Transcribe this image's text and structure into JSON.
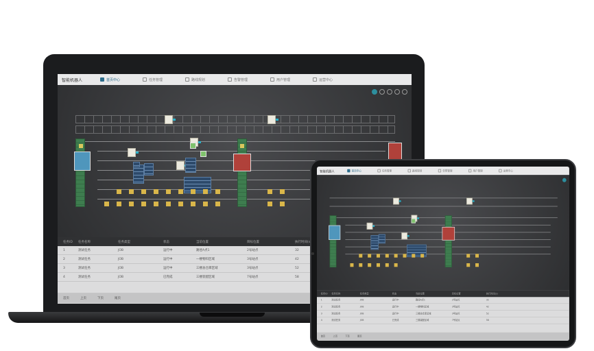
{
  "app": {
    "title": "智能机器人",
    "nav": [
      {
        "label": "首页中心",
        "icon": "dashboard-icon",
        "active": true
      },
      {
        "label": "任务管理",
        "icon": "task-icon",
        "active": false
      },
      {
        "label": "路线规划",
        "icon": "route-icon",
        "active": false
      },
      {
        "label": "告警管理",
        "icon": "alarm-icon",
        "active": false
      },
      {
        "label": "用户管理",
        "icon": "user-icon",
        "active": false
      },
      {
        "label": "运营中心",
        "icon": "ops-icon",
        "active": false
      }
    ],
    "pages": [
      "1",
      "2",
      "3",
      "4",
      "5"
    ],
    "table": {
      "headers": [
        "任务ID",
        "任务名称",
        "任务类型",
        "状态",
        "当前位置",
        "目标位置",
        "执行时间(s)"
      ],
      "rows": [
        [
          "1",
          "测试任务",
          "JOB",
          "运行中",
          "路径A点1",
          "2号站点",
          "32"
        ],
        [
          "2",
          "测试任务",
          "JOB",
          "运行中",
          "一楼物料区域",
          "3号站点",
          "42"
        ],
        [
          "3",
          "测试任务",
          "JOB",
          "运行中",
          "三楼总仓库区域",
          "3号站点",
          "52"
        ],
        [
          "4",
          "测试任务",
          "JOB",
          "已完成",
          "三楼装配区域",
          "7号站点",
          "58"
        ]
      ],
      "footer": [
        "首页",
        "上页",
        "下页",
        "尾页"
      ]
    }
  },
  "colors": {
    "accent": "#2d8f9e",
    "track_green": "#3e7d4f",
    "box_yellow": "#d9b64a"
  }
}
